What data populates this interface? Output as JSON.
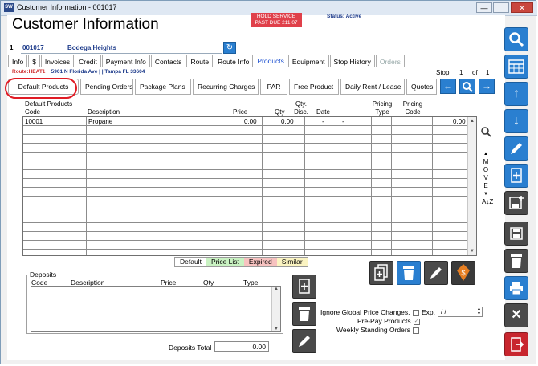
{
  "window": {
    "title": "Customer Information - 001017",
    "controls": [
      "—",
      "□",
      "✕"
    ]
  },
  "header": {
    "title": "Customer Information",
    "hold_line1": "HOLD SERVICE",
    "hold_line2": "PAST DUE  211.07",
    "status": "Status: Active"
  },
  "customer": {
    "number": "1",
    "account": "001017",
    "name": "Bodega Heights"
  },
  "tabs": [
    {
      "label": "Info",
      "state": "normal"
    },
    {
      "label": "$",
      "state": "normal"
    },
    {
      "label": "Invoices",
      "state": "normal"
    },
    {
      "label": "Credit",
      "state": "normal"
    },
    {
      "label": "Payment Info",
      "state": "normal"
    },
    {
      "label": "Contacts",
      "state": "normal"
    },
    {
      "label": "Route",
      "state": "normal"
    },
    {
      "label": "Route Info",
      "state": "normal"
    },
    {
      "label": "Products",
      "state": "active"
    },
    {
      "label": "Equipment",
      "state": "normal"
    },
    {
      "label": "Stop History",
      "state": "normal"
    },
    {
      "label": "Orders",
      "state": "disabled"
    }
  ],
  "route_line": {
    "route": "Route:HEAT1",
    "address": "5901 N Florida Ave |  | Tampa FL 33604"
  },
  "stop": {
    "label": "Stop",
    "current": "1",
    "of_label": "of",
    "total": "1"
  },
  "subtabs": [
    "Default Products",
    "Pending Orders",
    "Package Plans",
    "Recurring Charges",
    "PAR",
    "Free Product",
    "Daily Rent / Lease",
    "Quotes"
  ],
  "products_grid": {
    "group_label": "Default Products",
    "columns": [
      "Code",
      "Description",
      "Price",
      "Qty",
      "Qty. Disc.",
      "Date",
      "Pricing Type",
      "Pricing Code"
    ],
    "rows": [
      {
        "code": "10001",
        "description": "Propane",
        "price": "0.00",
        "qty": "0.00",
        "date1": "-",
        "date2": "-",
        "total": "0.00"
      }
    ]
  },
  "move": {
    "letters": [
      "M",
      "O",
      "V",
      "E"
    ],
    "sort_icon": "A↓Z"
  },
  "legend": [
    {
      "label": "Default",
      "color": "#ffffff"
    },
    {
      "label": "Price List",
      "color": "#c9f2c2"
    },
    {
      "label": "Expired",
      "color": "#f7c2c0"
    },
    {
      "label": "Similar",
      "color": "#fbf4c2"
    }
  ],
  "deposits": {
    "group_label": "Deposits",
    "columns": [
      "Code",
      "Description",
      "Price",
      "Qty",
      "Type"
    ],
    "total_label": "Deposits Total",
    "total_value": "0.00"
  },
  "options": {
    "ignore_global": "Ignore Global Price Changes.",
    "exp_label": "Exp.",
    "exp_value": " / /",
    "prepay": "Pre-Pay Products",
    "weekly": "Weekly Standing Orders"
  },
  "icons": {
    "search": "🔍",
    "up": "↑",
    "down": "↓",
    "left": "←",
    "right": "→",
    "refresh": "↻",
    "close": "✕"
  },
  "colors": {
    "accent_blue": "#2a7fd0",
    "dark_button": "#4a4a4a",
    "exit_red": "#c8262e",
    "hold_red": "#e0404a",
    "active_tab_text": "#1a4fd0",
    "highlight_ring": "#e01b24",
    "price_orange": "#e67e22"
  }
}
